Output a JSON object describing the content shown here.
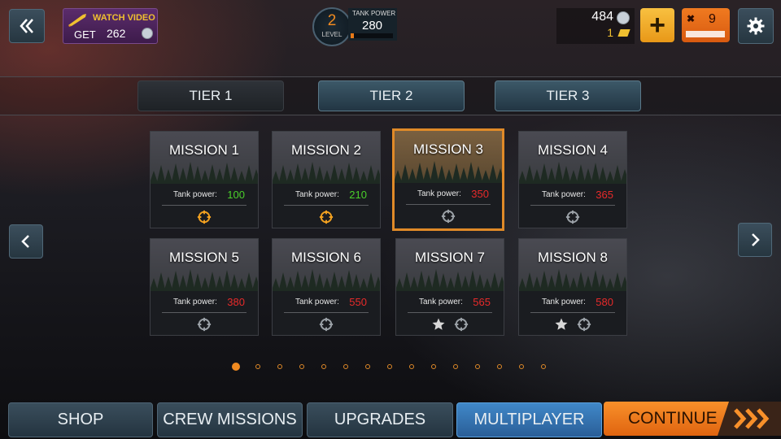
{
  "topbar": {
    "watch_video": {
      "title": "WATCH VIDEO",
      "get_label": "GET",
      "amount": "262"
    },
    "level": {
      "number": "2",
      "label": "LEVEL"
    },
    "tank_power": {
      "label": "TANK POWER",
      "value": "280",
      "fill_fraction": 0.08
    },
    "currency": {
      "silver": "484",
      "gold": "1"
    },
    "fuel": {
      "value": "9"
    }
  },
  "tiers": [
    {
      "label": "TIER 1",
      "active": false
    },
    {
      "label": "TIER 2",
      "active": true
    },
    {
      "label": "TIER 3",
      "active": false
    }
  ],
  "missions": [
    {
      "name": "MISSION 1",
      "power_label": "Tank power:",
      "power": "100",
      "power_color": "green",
      "target_icon": "orange",
      "star": false
    },
    {
      "name": "MISSION 2",
      "power_label": "Tank power:",
      "power": "210",
      "power_color": "green",
      "target_icon": "orange",
      "star": false
    },
    {
      "name": "MISSION 3",
      "power_label": "Tank power:",
      "power": "350",
      "power_color": "red",
      "target_icon": "gray",
      "star": false,
      "selected": true
    },
    {
      "name": "MISSION 4",
      "power_label": "Tank power:",
      "power": "365",
      "power_color": "red",
      "target_icon": "gray",
      "star": false
    },
    {
      "name": "MISSION 5",
      "power_label": "Tank power:",
      "power": "380",
      "power_color": "red",
      "target_icon": "gray",
      "star": false
    },
    {
      "name": "MISSION 6",
      "power_label": "Tank power:",
      "power": "550",
      "power_color": "red",
      "target_icon": "gray",
      "star": false
    },
    {
      "name": "MISSION 7",
      "power_label": "Tank power:",
      "power": "565",
      "power_color": "red",
      "target_icon": "gray",
      "star": true
    },
    {
      "name": "MISSION 8",
      "power_label": "Tank power:",
      "power": "580",
      "power_color": "red",
      "target_icon": "gray",
      "star": true
    }
  ],
  "pagination": {
    "total": 15,
    "current": 1
  },
  "bottom_nav": {
    "shop": "SHOP",
    "crew_missions": "CREW MISSIONS",
    "upgrades": "UPGRADES",
    "multiplayer": "MULTIPLAYER",
    "continue": "CONTINUE"
  },
  "colors": {
    "accent": "#f08a20",
    "green": "#4ad02a",
    "red": "#e82a2a",
    "multiplayer_blue": "#3a7cc0"
  }
}
